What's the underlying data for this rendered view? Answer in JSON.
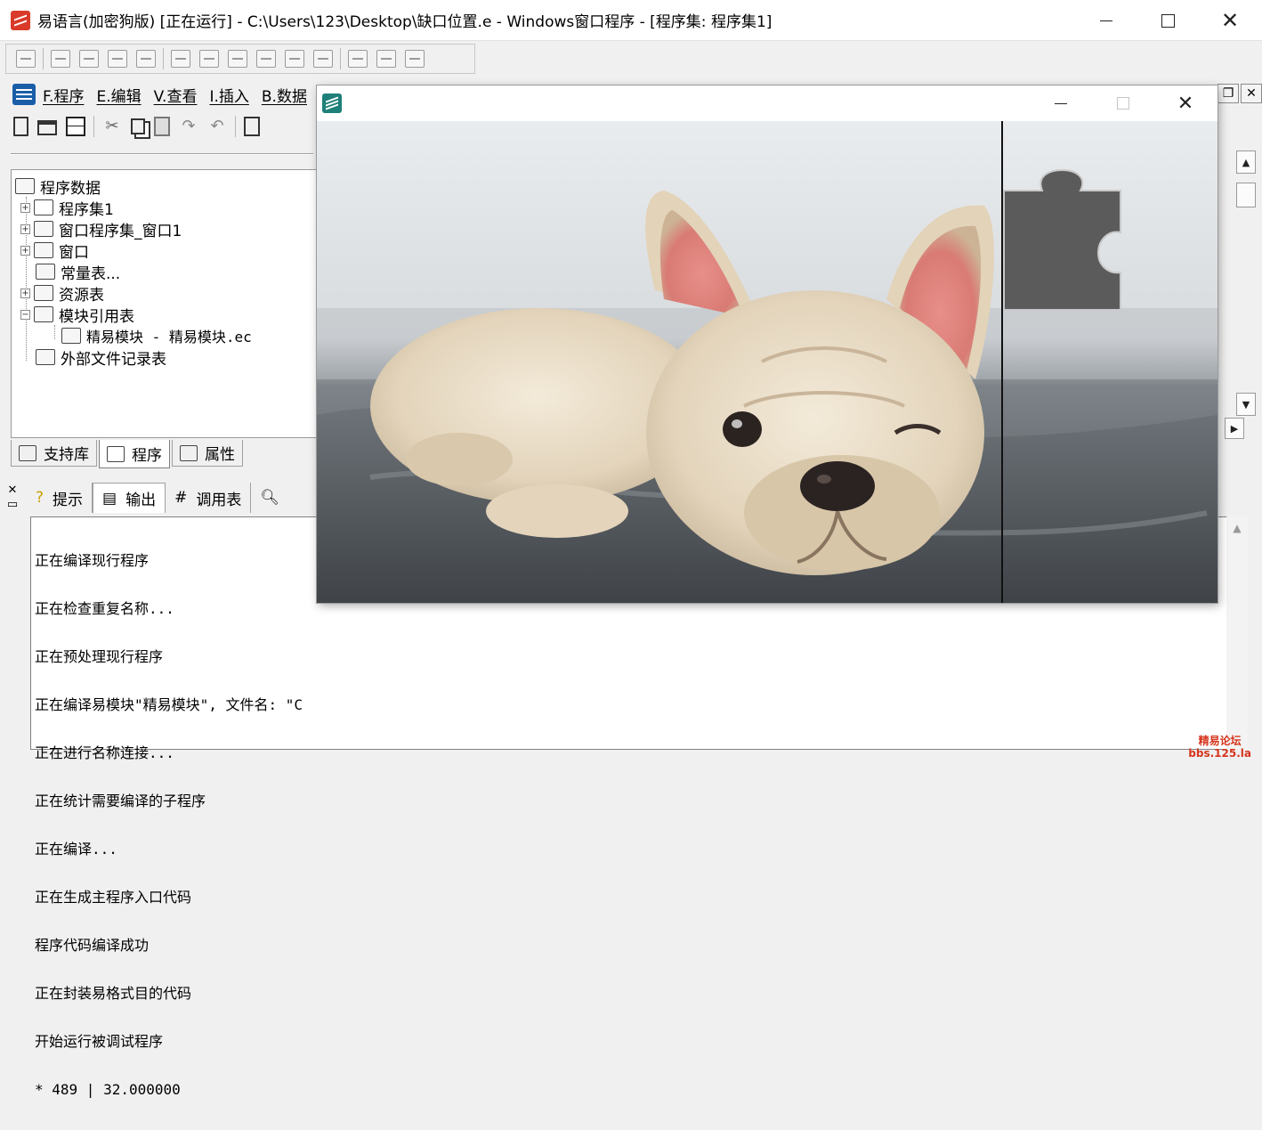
{
  "main_window": {
    "title": "易语言(加密狗版) [正在运行] - C:\\Users\\123\\Desktop\\缺口位置.e - Windows窗口程序 - [程序集: 程序集1]"
  },
  "menu": {
    "items": [
      "F.程序",
      "E.编辑",
      "V.查看",
      "I.插入",
      "B.数据"
    ]
  },
  "tree": {
    "root": "程序数据",
    "items": [
      {
        "label": "程序集1",
        "expander": "+"
      },
      {
        "label": "窗口程序集_窗口1",
        "expander": "+"
      },
      {
        "label": "窗口",
        "expander": "+"
      },
      {
        "label": "常量表...",
        "expander": ""
      },
      {
        "label": "资源表",
        "expander": "+"
      },
      {
        "label": "模块引用表",
        "expander": "−"
      },
      {
        "label": "精易模块 - 精易模块.ec",
        "expander": ""
      },
      {
        "label": "外部文件记录表",
        "expander": ""
      }
    ]
  },
  "left_tabs": [
    "支持库",
    "程序",
    "属性"
  ],
  "output_tabs": [
    "提示",
    "输出",
    "调用表"
  ],
  "output": {
    "lines": [
      "正在编译现行程序",
      "正在检查重复名称...",
      "正在预处理现行程序",
      "正在编译易模块\"精易模块\", 文件名: \"C",
      "正在进行名称连接...",
      "正在统计需要编译的子程序",
      "正在编译...",
      "正在生成主程序入口代码",
      "程序代码编译成功",
      "正在封装易格式目的代码",
      "开始运行被调试程序",
      "* 489 | 32.000000"
    ]
  },
  "watermark": {
    "line1": "精易论坛",
    "line2": "bbs.125.la"
  },
  "icons": {
    "app": "yi-language-logo-icon",
    "overlay_app": "yi-window-icon",
    "puzzle": "puzzle-piece-icon"
  },
  "colors": {
    "app_red": "#d93a2a",
    "overlay_icon": "#1f7f79",
    "puzzle_gray": "#5b5b5b"
  }
}
